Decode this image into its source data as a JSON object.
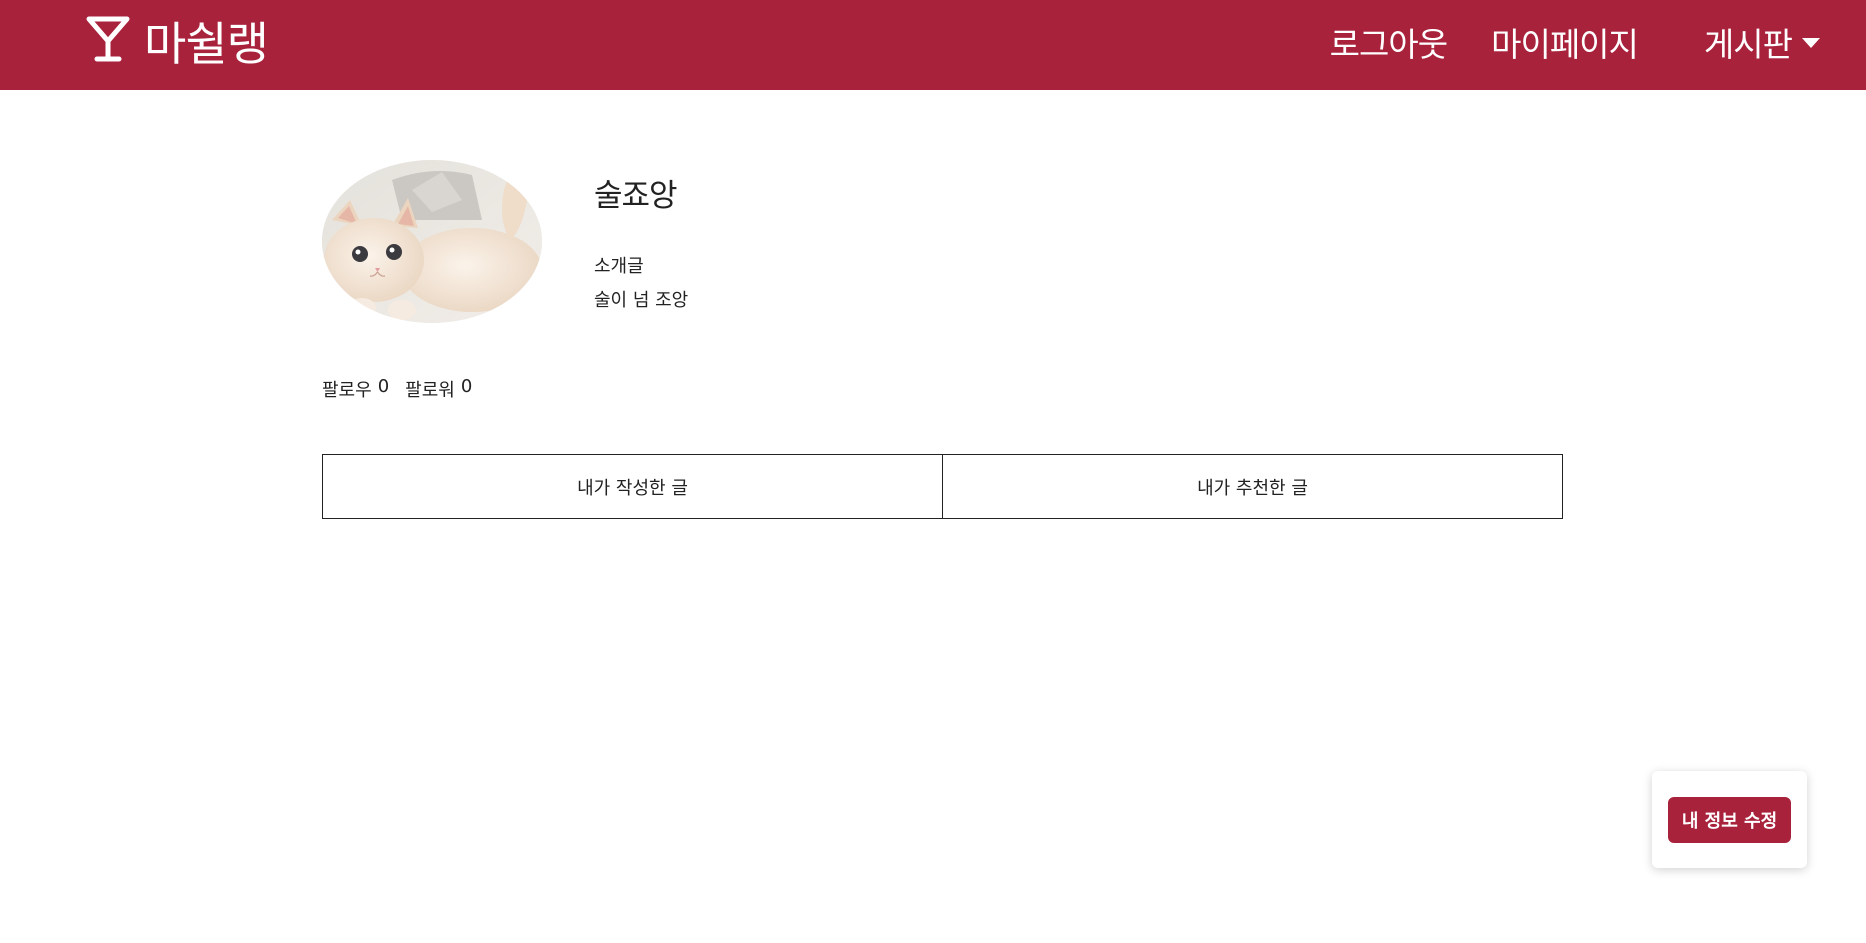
{
  "colors": {
    "brand": "#a9223c",
    "text": "#222222",
    "background": "#ffffff"
  },
  "navbar": {
    "brand_icon": "cocktail-glass-icon",
    "brand_name": "마쉴랭",
    "logout_label": "로그아웃",
    "mypage_label": "마이페이지",
    "board_label": "게시판",
    "board_caret_icon": "caret-down-icon"
  },
  "profile": {
    "avatar_icon": "cat-photo",
    "nickname": "술죠앙",
    "intro_label": "소개글",
    "intro_text": "술이 넘 조앙",
    "following_label": "팔로우",
    "following_count": "0",
    "followers_label": "팔로워",
    "followers_count": "0"
  },
  "tabs": [
    {
      "label": "내가 작성한 글"
    },
    {
      "label": "내가 추천한 글"
    }
  ],
  "edit_button_label": "내 정보 수정"
}
